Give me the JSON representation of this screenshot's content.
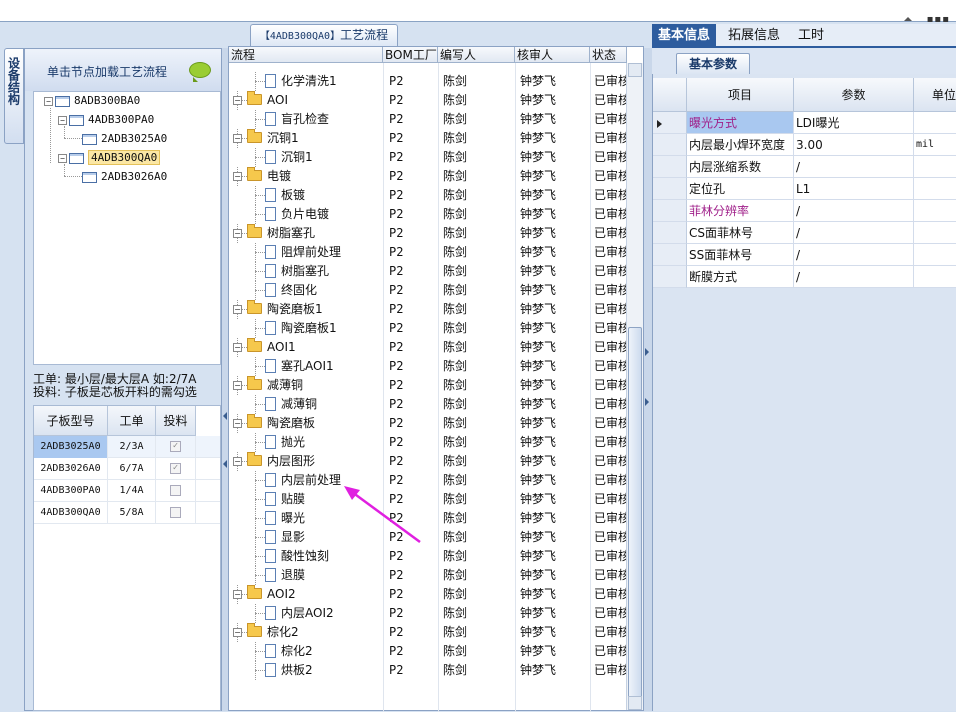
{
  "left_vertical_tab": "设备结构",
  "left_header": "单击节点加载工艺流程",
  "tree": [
    {
      "label": "8ADB300BA0"
    },
    {
      "label": "4ADB300PA0"
    },
    {
      "label": "2ADB3025A0"
    },
    {
      "label": "4ADB300QA0"
    },
    {
      "label": "2ADB3026A0"
    }
  ],
  "left_info": [
    "工单: 最小层/最大层A 如:2/7A",
    "投料: 子板是芯板开料的需勾选"
  ],
  "sub_grid": {
    "headers": [
      "子板型号",
      "工单",
      "投料"
    ],
    "rows": [
      {
        "model": "2ADB3025A0",
        "order": "2/3A",
        "checked": "✓"
      },
      {
        "model": "2ADB3026A0",
        "order": "6/7A",
        "checked": "✓"
      },
      {
        "model": "4ADB300PA0",
        "order": "1/4A",
        "checked": ""
      },
      {
        "model": "4ADB300QA0",
        "order": "5/8A",
        "checked": ""
      }
    ]
  },
  "middle_title": {
    "id": "【4ADB300QA0】",
    "label": "工艺流程"
  },
  "middle_headers": [
    "流程",
    "BOM工厂",
    "编写人",
    "核审人",
    "状态"
  ],
  "process_rows": [
    {
      "name": "化学清洗1",
      "level": 2,
      "bom": "P2",
      "writer": "陈剑",
      "reviewer": "钟梦飞",
      "status": "已审核"
    },
    {
      "name": "AOI",
      "level": 1,
      "bom": "P2",
      "writer": "陈剑",
      "reviewer": "钟梦飞",
      "status": "已审核"
    },
    {
      "name": "盲孔检查",
      "level": 2,
      "bom": "P2",
      "writer": "陈剑",
      "reviewer": "钟梦飞",
      "status": "已审核"
    },
    {
      "name": "沉铜1",
      "level": 1,
      "bom": "P2",
      "writer": "陈剑",
      "reviewer": "钟梦飞",
      "status": "已审核"
    },
    {
      "name": "沉铜1",
      "level": 2,
      "bom": "P2",
      "writer": "陈剑",
      "reviewer": "钟梦飞",
      "status": "已审核"
    },
    {
      "name": "电镀",
      "level": 1,
      "bom": "P2",
      "writer": "陈剑",
      "reviewer": "钟梦飞",
      "status": "已审核"
    },
    {
      "name": "板镀",
      "level": 2,
      "bom": "P2",
      "writer": "陈剑",
      "reviewer": "钟梦飞",
      "status": "已审核"
    },
    {
      "name": "负片电镀",
      "level": 2,
      "bom": "P2",
      "writer": "陈剑",
      "reviewer": "钟梦飞",
      "status": "已审核"
    },
    {
      "name": "树脂塞孔",
      "level": 1,
      "bom": "P2",
      "writer": "陈剑",
      "reviewer": "钟梦飞",
      "status": "已审核"
    },
    {
      "name": "阻焊前处理",
      "level": 2,
      "bom": "P2",
      "writer": "陈剑",
      "reviewer": "钟梦飞",
      "status": "已审核"
    },
    {
      "name": "树脂塞孔",
      "level": 2,
      "bom": "P2",
      "writer": "陈剑",
      "reviewer": "钟梦飞",
      "status": "已审核"
    },
    {
      "name": "终固化",
      "level": 2,
      "bom": "P2",
      "writer": "陈剑",
      "reviewer": "钟梦飞",
      "status": "已审核"
    },
    {
      "name": "陶瓷磨板1",
      "level": 1,
      "bom": "P2",
      "writer": "陈剑",
      "reviewer": "钟梦飞",
      "status": "已审核"
    },
    {
      "name": "陶瓷磨板1",
      "level": 2,
      "bom": "P2",
      "writer": "陈剑",
      "reviewer": "钟梦飞",
      "status": "已审核"
    },
    {
      "name": "AOI1",
      "level": 1,
      "bom": "P2",
      "writer": "陈剑",
      "reviewer": "钟梦飞",
      "status": "已审核"
    },
    {
      "name": "塞孔AOI1",
      "level": 2,
      "bom": "P2",
      "writer": "陈剑",
      "reviewer": "钟梦飞",
      "status": "已审核"
    },
    {
      "name": "减薄铜",
      "level": 1,
      "bom": "P2",
      "writer": "陈剑",
      "reviewer": "钟梦飞",
      "status": "已审核"
    },
    {
      "name": "减薄铜",
      "level": 2,
      "bom": "P2",
      "writer": "陈剑",
      "reviewer": "钟梦飞",
      "status": "已审核"
    },
    {
      "name": "陶瓷磨板",
      "level": 1,
      "bom": "P2",
      "writer": "陈剑",
      "reviewer": "钟梦飞",
      "status": "已审核"
    },
    {
      "name": "抛光",
      "level": 2,
      "bom": "P2",
      "writer": "陈剑",
      "reviewer": "钟梦飞",
      "status": "已审核"
    },
    {
      "name": "内层图形",
      "level": 1,
      "bom": "P2",
      "writer": "陈剑",
      "reviewer": "钟梦飞",
      "status": "已审核"
    },
    {
      "name": "内层前处理",
      "level": 2,
      "bom": "P2",
      "writer": "陈剑",
      "reviewer": "钟梦飞",
      "status": "已审核"
    },
    {
      "name": "贴膜",
      "level": 2,
      "bom": "P2",
      "writer": "陈剑",
      "reviewer": "钟梦飞",
      "status": "已审核"
    },
    {
      "name": "曝光",
      "level": 2,
      "bom": "P2",
      "writer": "陈剑",
      "reviewer": "钟梦飞",
      "status": "已审核"
    },
    {
      "name": "显影",
      "level": 2,
      "bom": "P2",
      "writer": "陈剑",
      "reviewer": "钟梦飞",
      "status": "已审核"
    },
    {
      "name": "酸性蚀刻",
      "level": 2,
      "bom": "P2",
      "writer": "陈剑",
      "reviewer": "钟梦飞",
      "status": "已审核"
    },
    {
      "name": "退膜",
      "level": 2,
      "bom": "P2",
      "writer": "陈剑",
      "reviewer": "钟梦飞",
      "status": "已审核"
    },
    {
      "name": "AOI2",
      "level": 1,
      "bom": "P2",
      "writer": "陈剑",
      "reviewer": "钟梦飞",
      "status": "已审核"
    },
    {
      "name": "内层AOI2",
      "level": 2,
      "bom": "P2",
      "writer": "陈剑",
      "reviewer": "钟梦飞",
      "status": "已审核"
    },
    {
      "name": "棕化2",
      "level": 1,
      "bom": "P2",
      "writer": "陈剑",
      "reviewer": "钟梦飞",
      "status": "已审核"
    },
    {
      "name": "棕化2",
      "level": 2,
      "bom": "P2",
      "writer": "陈剑",
      "reviewer": "钟梦飞",
      "status": "已审核"
    },
    {
      "name": "烘板2",
      "level": 2,
      "bom": "P2",
      "writer": "陈剑",
      "reviewer": "钟梦飞",
      "status": "已审核"
    }
  ],
  "right_tabs": [
    "基本信息",
    "拓展信息",
    "工时"
  ],
  "right_subtab": "基本参数",
  "param_headers": [
    "项目",
    "参数",
    "单位"
  ],
  "params": [
    {
      "item": "曝光方式",
      "value": "LDI曝光",
      "unit": "",
      "highlight": true
    },
    {
      "item": "内层最小焊环宽度",
      "value": "3.00",
      "unit": "mil",
      "highlight": false
    },
    {
      "item": "内层涨缩系数",
      "value": "/",
      "unit": "",
      "highlight": false
    },
    {
      "item": "定位孔",
      "value": "L1",
      "unit": "",
      "highlight": false
    },
    {
      "item": "菲林分辨率",
      "value": "/",
      "unit": "",
      "highlight": true
    },
    {
      "item": "CS面菲林号",
      "value": "/",
      "unit": "",
      "highlight": false
    },
    {
      "item": "SS面菲林号",
      "value": "/",
      "unit": "",
      "highlight": false
    },
    {
      "item": "断膜方式",
      "value": "/",
      "unit": "",
      "highlight": false
    }
  ],
  "colors": {
    "accent": "#2d5c9e",
    "highlight_text": "#a0208a",
    "annotation_arrow": "#e020e0",
    "selected_cell": "#a9c8f0"
  }
}
